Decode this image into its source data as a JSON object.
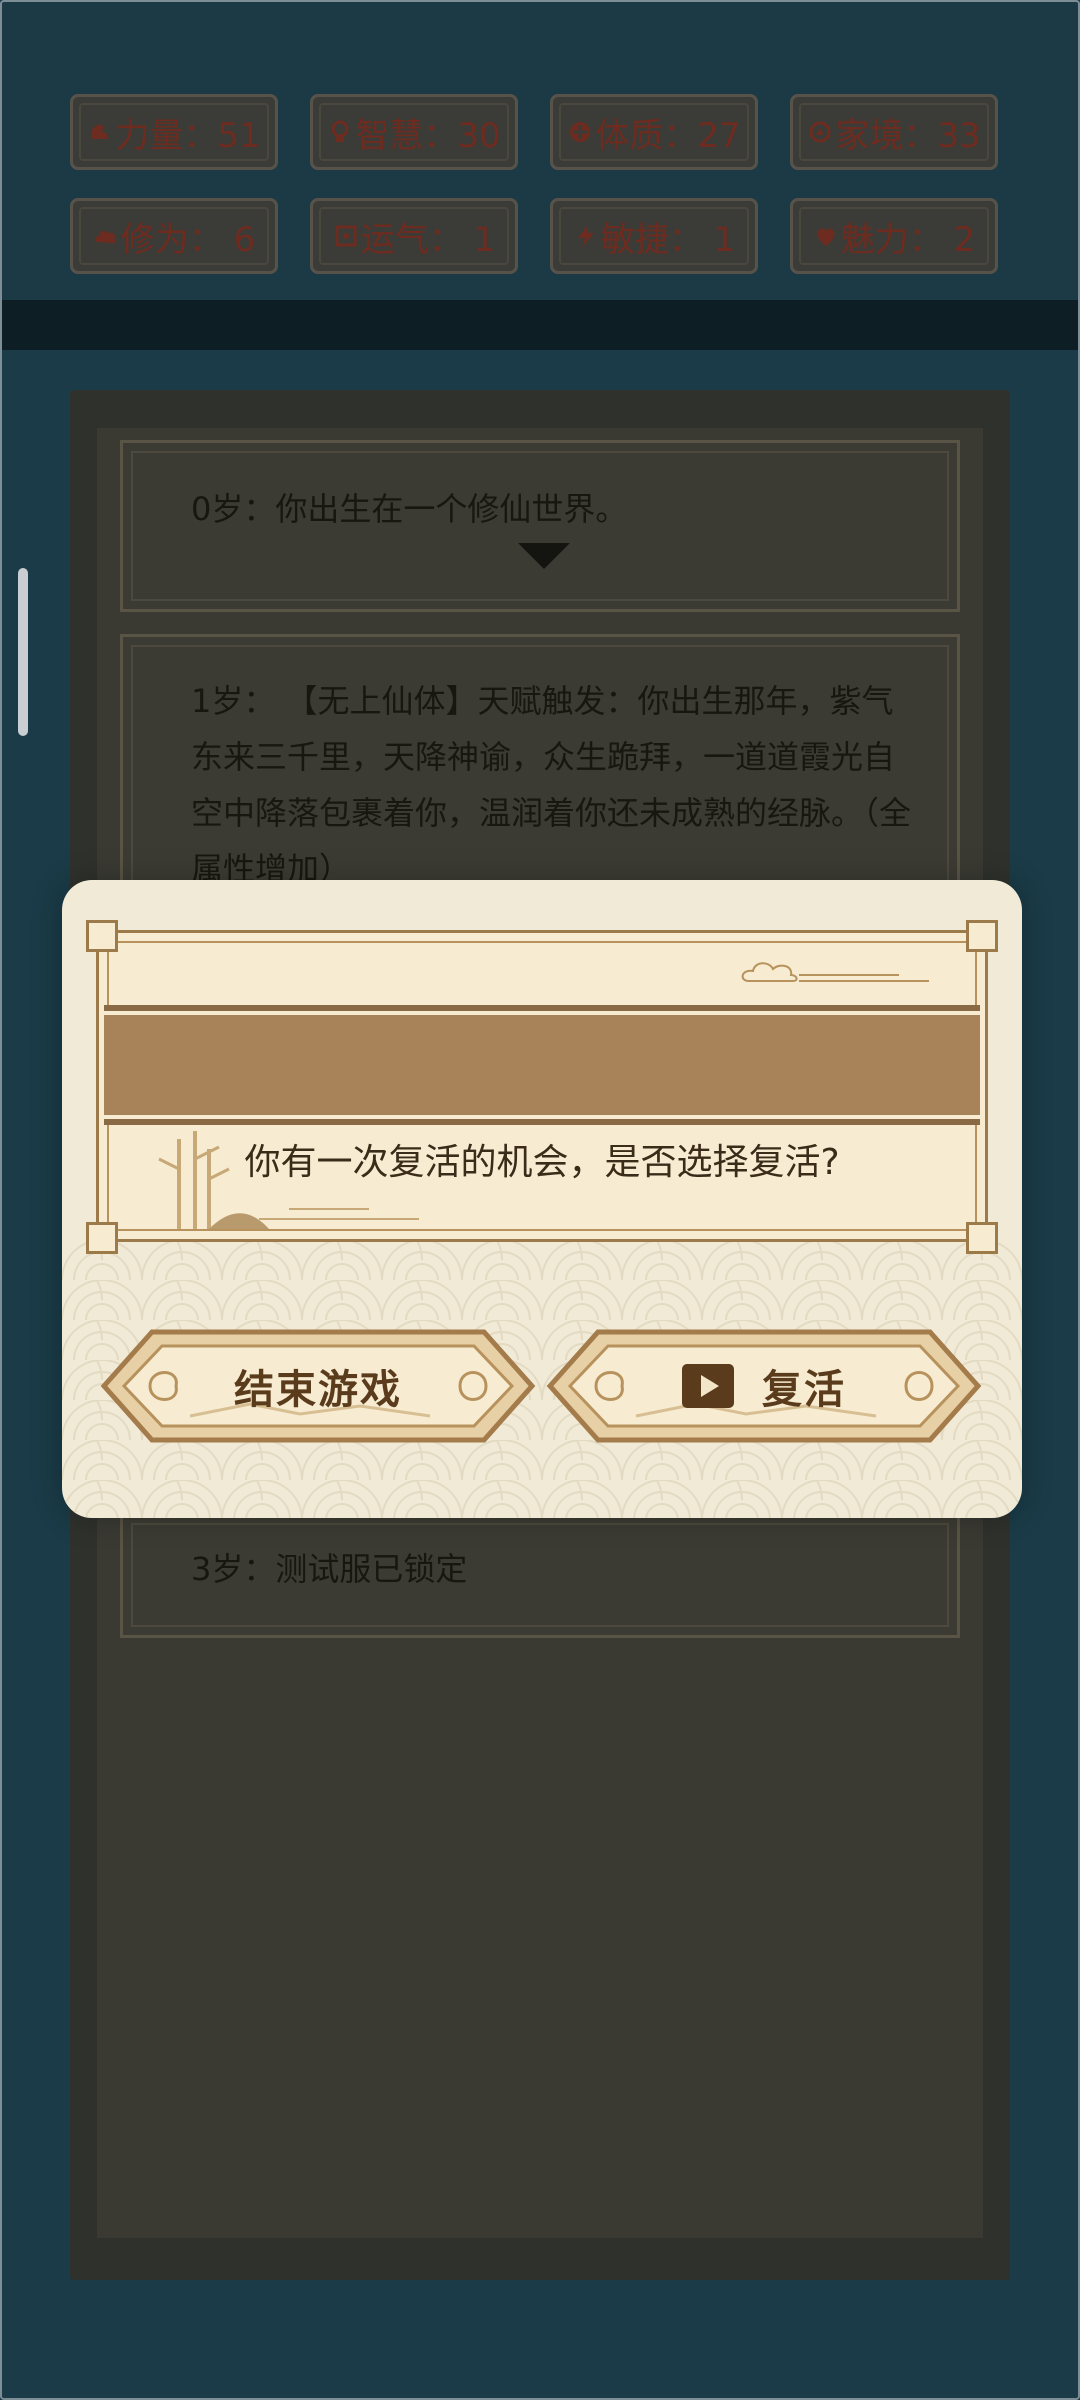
{
  "stats": [
    {
      "icon": "strength-icon",
      "label": "力量：51"
    },
    {
      "icon": "wisdom-icon",
      "label": "智慧：30"
    },
    {
      "icon": "constitution-icon",
      "label": "体质：27"
    },
    {
      "icon": "family-icon",
      "label": "家境：33"
    },
    {
      "icon": "cultivation-icon",
      "label": "修为： 6"
    },
    {
      "icon": "luck-icon",
      "label": "运气： 1"
    },
    {
      "icon": "agility-icon",
      "label": "敏捷： 1"
    },
    {
      "icon": "charm-icon",
      "label": "魅力： 2"
    }
  ],
  "log": [
    {
      "text": "0岁：你出生在一个修仙世界。"
    },
    {
      "text": "1岁： 【无上仙体】天赋触发：你出生那年，紫气东来三千里，天降神谕，众生跪拜，一道道霞光自空中降落包裹着你，温润着你还未成熟的经脉。（全属性增加）"
    },
    {
      "text": "3岁：测试服已锁定"
    }
  ],
  "dialog": {
    "message": "你有一次复活的机会，是否选择复活?",
    "end_game_label": "结束游戏",
    "revive_label": "复活"
  },
  "colors": {
    "dialog_bg": "#f1ead7",
    "accent_brown": "#a8835a",
    "button_text": "#5a3b1c",
    "stat_text": "#6e2b1f"
  }
}
